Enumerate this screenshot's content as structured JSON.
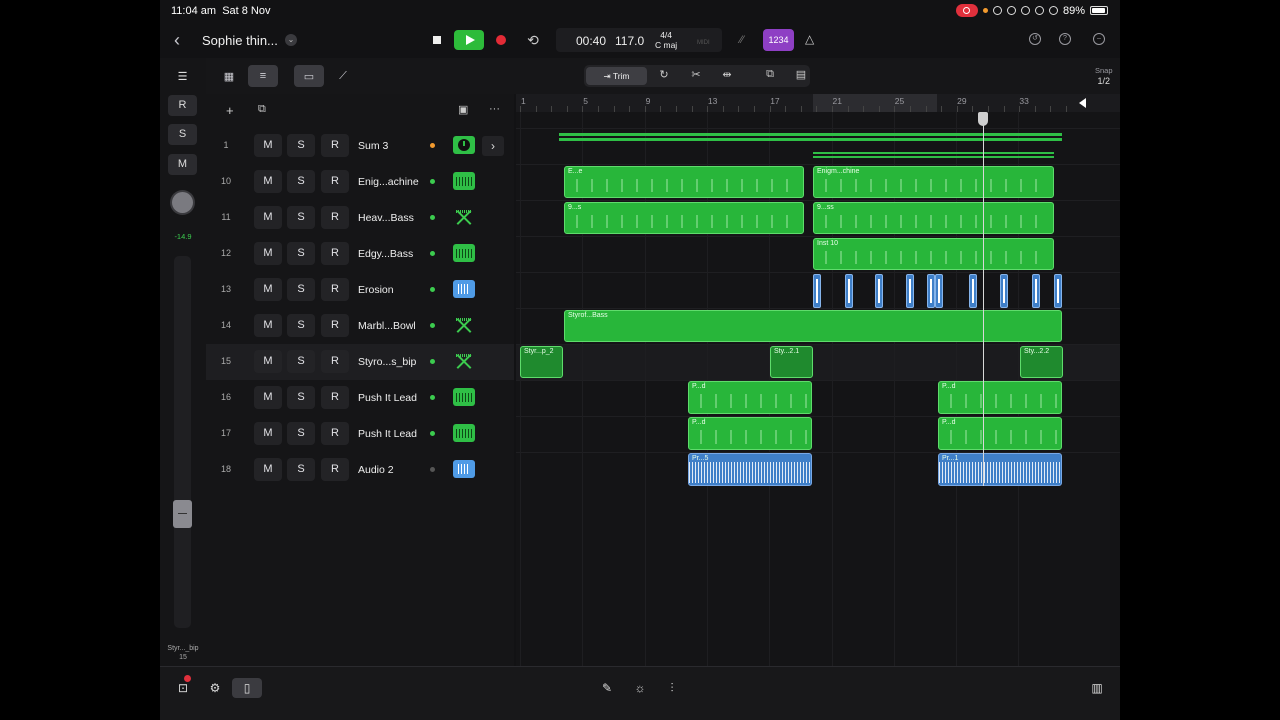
{
  "status_bar": {
    "time": "11:04 am",
    "date": "Sat 8 Nov",
    "battery": "89%"
  },
  "topbar": {
    "project_name": "Sophie thin...",
    "position": "00:40",
    "tempo": "117.0",
    "time_signature": "4/4",
    "key": "C maj",
    "midi_label": "MIDI",
    "count_in_label": "1234"
  },
  "inspector": {
    "record_label": "R",
    "solo_label": "S",
    "mute_label": "M",
    "volume": "-14.9",
    "track_name": "Styr..._bip",
    "track_number": "15"
  },
  "toolbar": {
    "trim_label": "Trim",
    "snap_label": "Snap",
    "snap_value": "1/2"
  },
  "tracks": [
    {
      "num": "1",
      "name": "Sum 3",
      "icon": "summing-stack-icon",
      "dot": "#f29a2e"
    },
    {
      "num": "10",
      "name": "Enig...achine",
      "icon": "synth-icon",
      "dot": "#3ccc4f"
    },
    {
      "num": "11",
      "name": "Heav...Bass",
      "icon": "x-synth-icon",
      "dot": "#3ccc4f"
    },
    {
      "num": "12",
      "name": "Edgy...Bass",
      "icon": "synth-icon",
      "dot": "#3ccc4f"
    },
    {
      "num": "13",
      "name": "Erosion",
      "icon": "audio-waveform-icon",
      "dot": "#3ccc4f"
    },
    {
      "num": "14",
      "name": "Marbl...Bowl",
      "icon": "x-synth-icon",
      "dot": "#3ccc4f"
    },
    {
      "num": "15",
      "name": "Styro...s_bip",
      "icon": "x-synth-icon",
      "dot": "#3ccc4f"
    },
    {
      "num": "16",
      "name": "Push It Lead",
      "icon": "synth-icon",
      "dot": "#3ccc4f"
    },
    {
      "num": "17",
      "name": "Push It Lead",
      "icon": "synth-icon",
      "dot": "#3ccc4f"
    },
    {
      "num": "18",
      "name": "Audio 2",
      "icon": "audio-waveform-icon",
      "dot": "#555555"
    }
  ],
  "button_labels": {
    "mute": "M",
    "solo": "S",
    "record": "R"
  },
  "ruler": {
    "bars": [
      "1",
      "5",
      "9",
      "13",
      "17",
      "21",
      "25",
      "29",
      "33"
    ]
  },
  "regions": {
    "enig_1": "E...e",
    "enig_2": "Enigm...chine",
    "heav_1": "9...s",
    "heav_2": "9...ss",
    "edgy": "Inst 10",
    "marbl": "Styrof...Bass",
    "styro_1": "Styr...p_2",
    "styro_2": "Sty...2.1",
    "styro_3": "Sty...2.2",
    "push16_1": "P...d",
    "push16_2": "P...d",
    "push17_1": "P...d",
    "push17_2": "P...d",
    "audio_1": "Pr...5",
    "audio_2": "Pr...1"
  },
  "colors": {
    "midi_region": "#28b63a",
    "audio_region": "#3f7fc8",
    "play": "#2dbb3a",
    "record": "#e32b36",
    "count_in": "#8e3fc4"
  }
}
